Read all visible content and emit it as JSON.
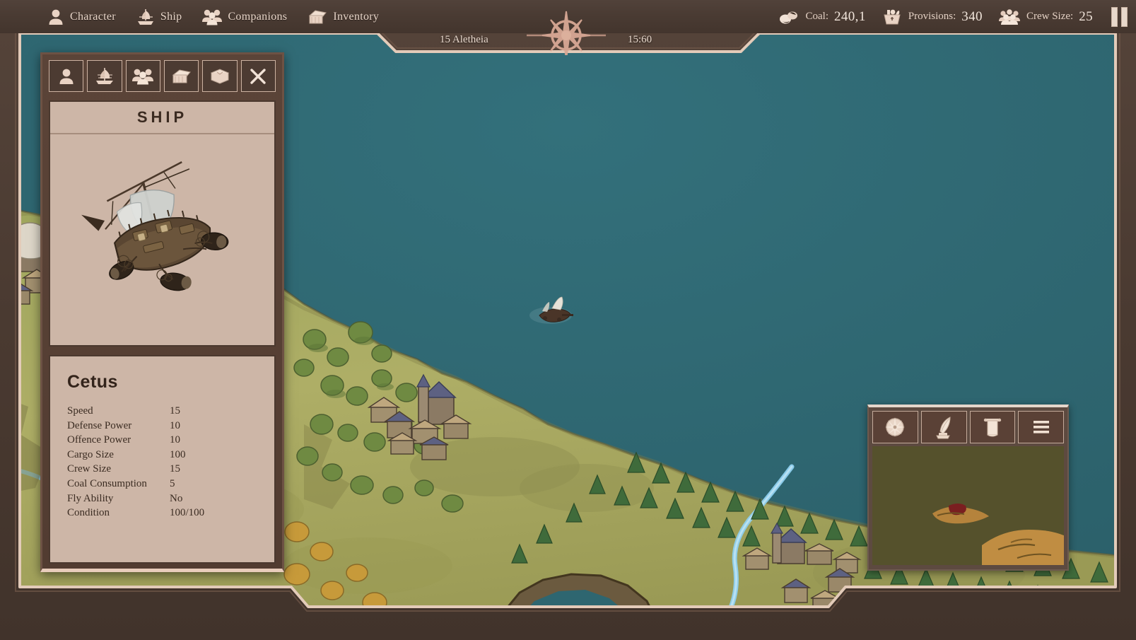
{
  "topbar": {
    "menu": [
      {
        "label": "Character",
        "icon": "person-icon"
      },
      {
        "label": "Ship",
        "icon": "ship-icon"
      },
      {
        "label": "Companions",
        "icon": "companions-icon"
      },
      {
        "label": "Inventory",
        "icon": "chest-icon"
      }
    ],
    "stats": [
      {
        "label": "Coal:",
        "value": "240,1",
        "icon": "coal-icon"
      },
      {
        "label": "Provisions:",
        "value": "340",
        "icon": "basket-icon"
      },
      {
        "label": "Crew Size:",
        "value": "25",
        "icon": "crew-icon"
      }
    ],
    "pause_label": "pause-button"
  },
  "datetime": {
    "date": "15 Aletheia",
    "time": "15:60",
    "compass_icon": "compass-rose-icon"
  },
  "panel": {
    "tabs": [
      {
        "icon": "person-icon",
        "name": "tab-character"
      },
      {
        "icon": "ship-icon",
        "name": "tab-ship",
        "active": true
      },
      {
        "icon": "companions-icon",
        "name": "tab-companions"
      },
      {
        "icon": "chest-icon",
        "name": "tab-inventory"
      },
      {
        "icon": "book-icon",
        "name": "tab-journal"
      },
      {
        "icon": "close-icon",
        "name": "close-panel"
      }
    ],
    "title": "SHIP",
    "artwork_name": "airship-illustration",
    "ship_name": "Cetus",
    "stats": [
      {
        "key": "Speed",
        "value": "15"
      },
      {
        "key": "Defense Power",
        "value": "10"
      },
      {
        "key": "Offence Power",
        "value": "10"
      },
      {
        "key": "Cargo Size",
        "value": "100"
      },
      {
        "key": "Crew Size",
        "value": "15"
      },
      {
        "key": "Coal Consumption",
        "value": "5"
      },
      {
        "key": "Fly Ability",
        "value": "No"
      },
      {
        "key": "Condition",
        "value": "100/100"
      }
    ]
  },
  "minimap": {
    "tabs": [
      {
        "icon": "compass-icon",
        "name": "minimap-tab-compass"
      },
      {
        "icon": "quill-icon",
        "name": "minimap-tab-quill"
      },
      {
        "icon": "scroll-icon",
        "name": "minimap-tab-scroll"
      },
      {
        "icon": "hamburger-icon",
        "name": "minimap-tab-menu"
      }
    ]
  },
  "colors": {
    "water": "#2f6670",
    "land": "#a7ab64",
    "frame": "#4a3a31",
    "frame_light": "#e3cbb9",
    "panel_bg": "#cdb6a7",
    "panel_frame": "#5b4438",
    "text_dark": "#33241b",
    "text_light": "#e8d5c8",
    "minimap_bg": "#55512c"
  }
}
